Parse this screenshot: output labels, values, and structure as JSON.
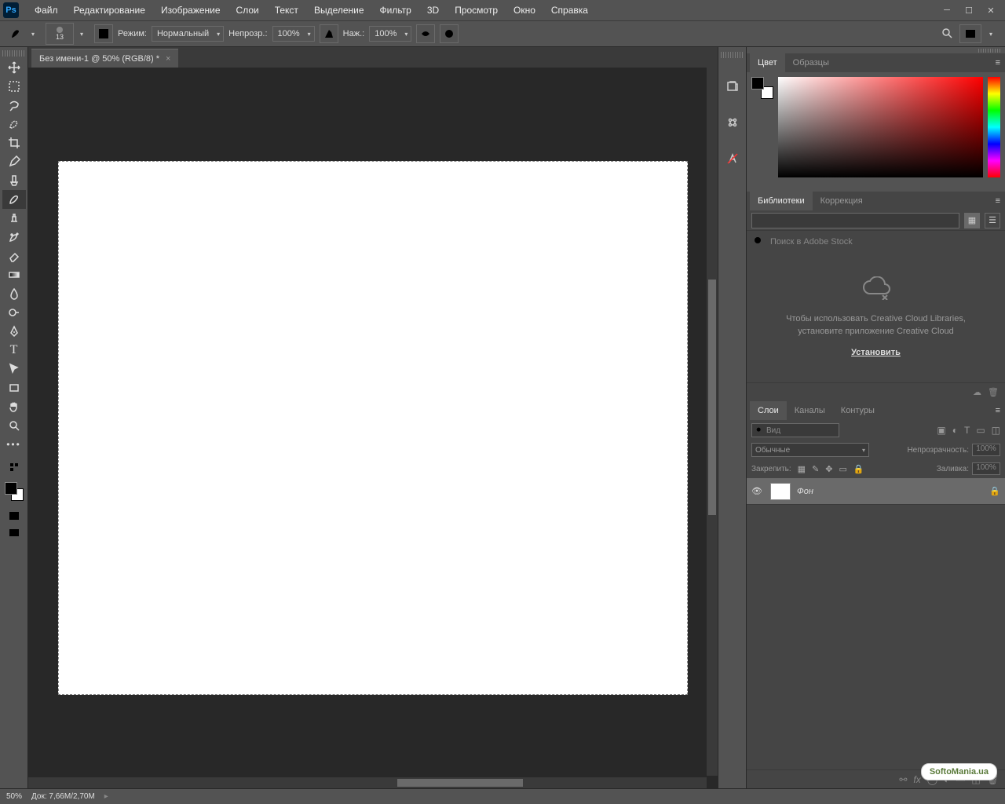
{
  "menu": {
    "items": [
      "Файл",
      "Редактирование",
      "Изображение",
      "Слои",
      "Текст",
      "Выделение",
      "Фильтр",
      "3D",
      "Просмотр",
      "Окно",
      "Справка"
    ]
  },
  "options": {
    "brush_size": "13",
    "mode_label": "Режим:",
    "mode_value": "Нормальный",
    "opacity_label": "Непрозр.:",
    "opacity_value": "100%",
    "flow_label": "Наж.:",
    "flow_value": "100%"
  },
  "document": {
    "tab_title": "Без имени-1 @ 50% (RGB/8) *"
  },
  "panels": {
    "color": {
      "tabs": [
        "Цвет",
        "Образцы"
      ]
    },
    "libraries": {
      "tabs": [
        "Библиотеки",
        "Коррекция"
      ],
      "search_placeholder": "Поиск в Adobe Stock",
      "msg1": "Чтобы использовать Creative Cloud Libraries,",
      "msg2": "установите приложение Creative Cloud",
      "install": "Установить"
    },
    "layers": {
      "tabs": [
        "Слои",
        "Каналы",
        "Контуры"
      ],
      "kind_label": "Вид",
      "mode_value": "Обычные",
      "opacity_label": "Непрозрачность:",
      "opacity_value": "100%",
      "lock_label": "Закрепить:",
      "fill_label": "Заливка:",
      "fill_value": "100%",
      "layer1_name": "Фон"
    }
  },
  "status": {
    "zoom": "50%",
    "doc_label": "Док:",
    "doc_size": "7,66M/2,70M"
  },
  "watermark": "SoftoMania.ua"
}
